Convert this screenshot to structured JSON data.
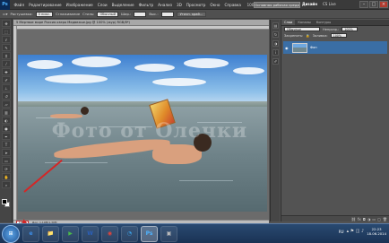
{
  "menubar": {
    "items": [
      "Файл",
      "Редактирование",
      "Изображение",
      "Слои",
      "Выделение",
      "Фильтр",
      "Анализ",
      "3D",
      "Просмотр",
      "Окно",
      "Справка"
    ],
    "zoom": "100%",
    "workspace": "Основная рабочая среда",
    "design": "Дизайн",
    "cslive": "CS Live"
  },
  "options": {
    "feather_label": "Растушевка:",
    "feather_value": "0 пикс.",
    "smoothing_label": "Сглаживание",
    "style_label": "Стиль:",
    "style_value": "Обычный",
    "width_label": "Шир.:",
    "height_label": "Выс.:",
    "refine_button": "Уточн. край..."
  },
  "document": {
    "tab_title": "5 Мертвое море Россия озеро Медвежье.jpg @ 100% (жур) RGB/8*)",
    "watermark": "Фото от Олечки",
    "status_zoom": "100%",
    "status_info": "Док: 1,10M/1,30M"
  },
  "layers_panel": {
    "tabs": [
      "Слои",
      "Каналы",
      "Контуры"
    ],
    "blend_mode": "Обычные",
    "opacity_label": "Непрозр.:",
    "opacity_value": "100%",
    "lock_label": "Закрепить:",
    "fill_label": "Заливка:",
    "fill_value": "100%",
    "layer_name": "Фон"
  },
  "taskbar": {
    "start": "⊞",
    "apps": [
      {
        "label": "e",
        "color": "#3d8ee8"
      },
      {
        "label": "📁",
        "color": "#e8c24a"
      },
      {
        "label": "▶",
        "color": "#4ab84a"
      },
      {
        "label": "W",
        "color": "#2b5fb8"
      },
      {
        "label": "◉",
        "color": "#e0443c"
      },
      {
        "label": "◔",
        "color": "#3aa0e8"
      },
      {
        "label": "Ps",
        "color": "#4fb3ff"
      },
      {
        "label": "▣",
        "color": "#bbbbbb"
      }
    ],
    "language": "RU",
    "time": "22:23",
    "date": "18.06.2014"
  }
}
